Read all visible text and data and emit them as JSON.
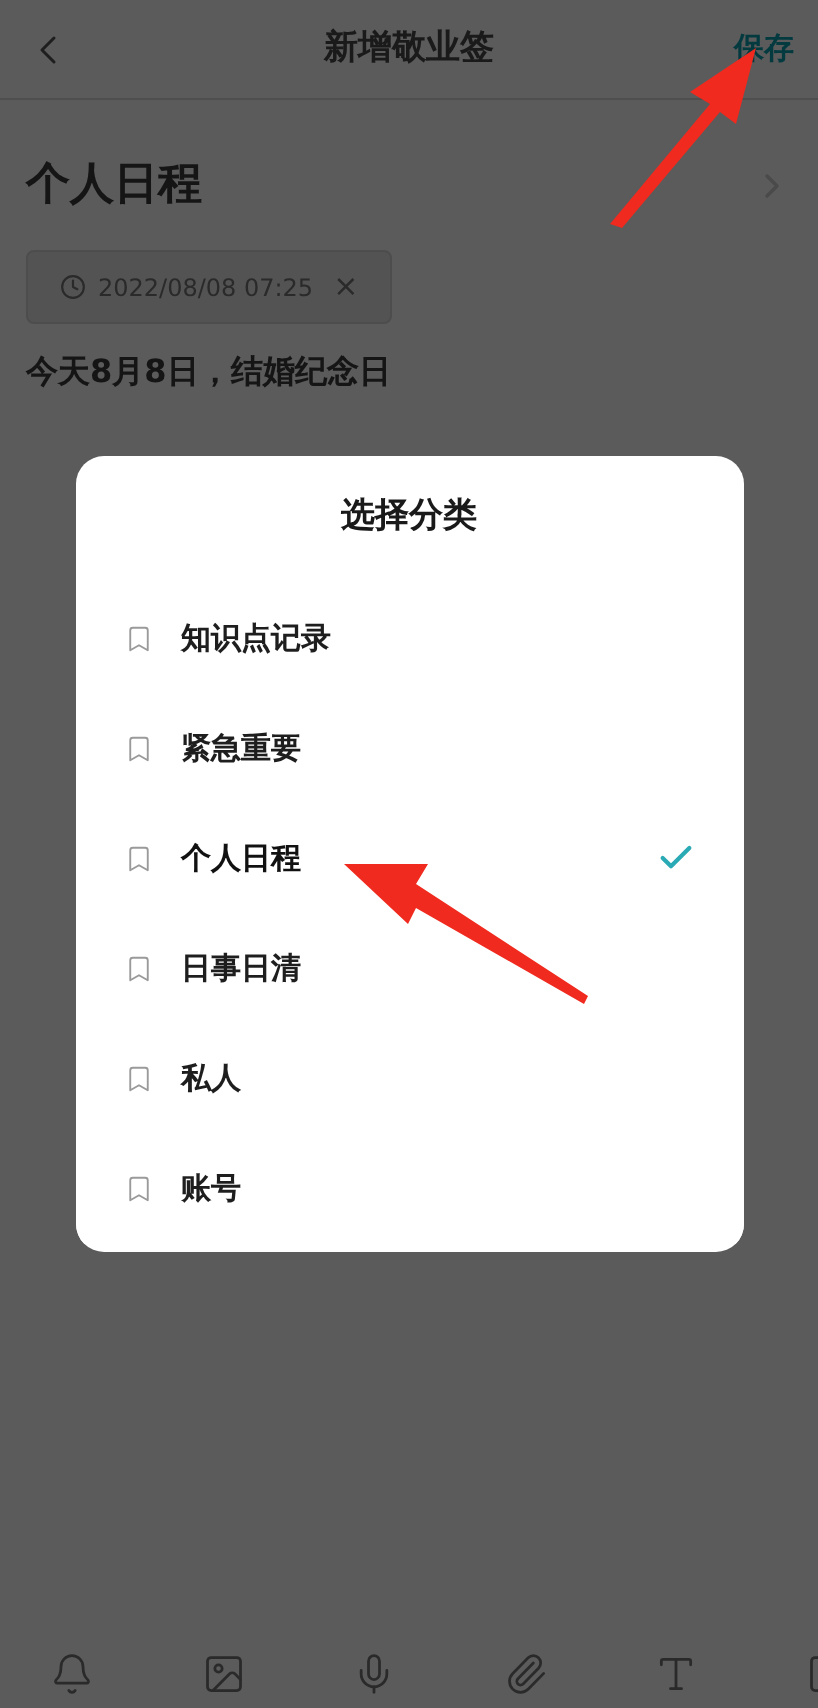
{
  "header": {
    "title": "新增敬业签",
    "save": "保存"
  },
  "note": {
    "category": "个人日程",
    "reminder": "2022/08/08 07:25",
    "reminder_clear": "×",
    "body": "今天8月8日，结婚纪念日"
  },
  "dialog": {
    "title": "选择分类",
    "items": [
      {
        "label": "知识点记录",
        "selected": false
      },
      {
        "label": "紧急重要",
        "selected": false
      },
      {
        "label": "个人日程",
        "selected": true
      },
      {
        "label": "日事日清",
        "selected": false
      },
      {
        "label": "私人",
        "selected": false
      },
      {
        "label": "账号",
        "selected": false
      }
    ]
  }
}
